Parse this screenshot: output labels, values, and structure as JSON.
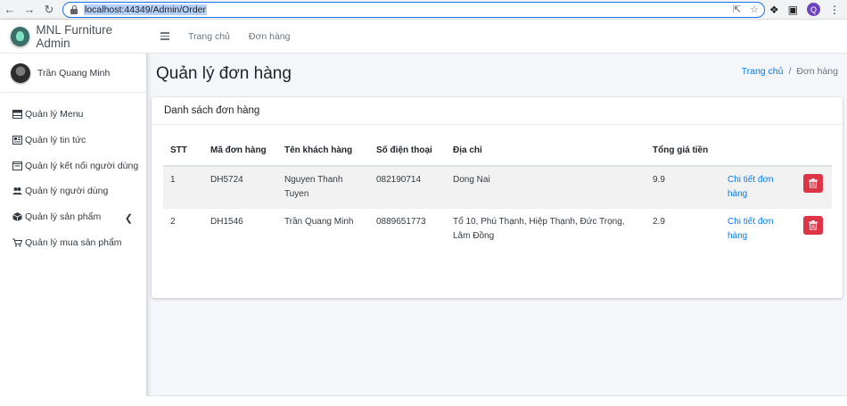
{
  "browser": {
    "url": "localhost:44349/Admin/Order",
    "profile_initial": "Q"
  },
  "brand": {
    "name": "MNL Furniture Admin"
  },
  "user": {
    "name": "Trần Quang Minh"
  },
  "sidebar": {
    "items": [
      {
        "label": "Quản lý Menu",
        "icon": "menu-table-icon"
      },
      {
        "label": "Quản lý tin tức",
        "icon": "newspaper-icon"
      },
      {
        "label": "Quản lý kết nối người dùng",
        "icon": "window-icon"
      },
      {
        "label": "Quản lý người dùng",
        "icon": "users-icon"
      },
      {
        "label": "Quản lý sản phẩm",
        "icon": "box-icon"
      },
      {
        "label": "Quản lý mua sản phẩm",
        "icon": "cart-icon"
      }
    ]
  },
  "topnav": {
    "home": "Trang chủ",
    "orders": "Đơn hàng"
  },
  "page": {
    "title": "Quản lý đơn hàng",
    "breadcrumb_home": "Trang chủ",
    "breadcrumb_sep": "/",
    "breadcrumb_current": "Đơn hàng"
  },
  "card": {
    "title": "Danh sách đơn hàng",
    "headers": [
      "STT",
      "Mã đơn hàng",
      "Tên khách hàng",
      "Số điện thoại",
      "Địa chỉ",
      "Tổng giá tiền"
    ],
    "rows": [
      {
        "stt": "1",
        "code": "DH5724",
        "customer": "Nguyen Thanh Tuyen",
        "phone": "082190714",
        "address": "Dong Nai",
        "total": "9.9",
        "detail": "Chi tiết đơn hàng"
      },
      {
        "stt": "2",
        "code": "DH1546",
        "customer": "Trần Quang Minh",
        "phone": "0889651773",
        "address": "Tổ 10, Phú Thạnh, Hiệp Thạnh, Đức Trọng, Lâm Đồng",
        "total": "2.9",
        "detail": "Chi tiết đơn hàng"
      }
    ]
  },
  "colors": {
    "danger": "#dc3545",
    "link": "#007bff",
    "url_highlight": "#b4d0f7"
  }
}
